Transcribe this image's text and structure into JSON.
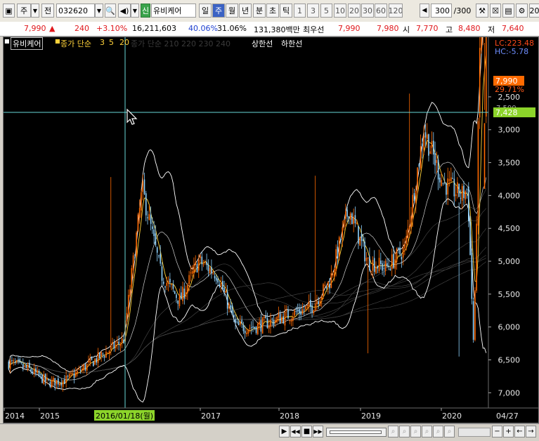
{
  "toolbar": {
    "market_label": "주",
    "prev_label": "전",
    "stock_code": "032620",
    "credit_badge": "신",
    "stock_name": "유비케어",
    "periods": [
      "일",
      "주",
      "월",
      "년",
      "분",
      "초",
      "틱"
    ],
    "selected_period": "주",
    "minute_intervals": [
      "1",
      "3",
      "5",
      "10",
      "20",
      "30",
      "60",
      "120"
    ],
    "count_value": "300",
    "count_total": "/300",
    "edge_label": "20"
  },
  "quote": {
    "price": "7,990",
    "change_arrow": "▲",
    "change": "240",
    "change_pct": "+3.10%",
    "volume": "16,211,603",
    "vol_ratio": "40.06%",
    "turnover_pct": "31.06%",
    "amount": "131,380백만",
    "best_ask_label": "최우선",
    "best_ask": "7,990",
    "best_bid": "7,980",
    "open_label": "시",
    "open": "7,770",
    "high_label": "고",
    "high": "8,480",
    "low_label": "저",
    "low": "7,640"
  },
  "chart_header": {
    "stock": "유비케어",
    "ma_label": "종가 단순",
    "ma_periods": [
      "3",
      "5",
      "20"
    ],
    "ma_periods_faded": "종가 단순 210  220  230  240",
    "upper_band": "상한선",
    "lower_band": "하한선"
  },
  "price_axis": {
    "lc": "LC:223.48",
    "hc": "HC:-5.78",
    "current_tag": "7,990",
    "current_pct": "29.71%",
    "cursor_tag": "7,428",
    "partial_tick": "7,500",
    "ticks": [
      "7,000",
      "6,500",
      "6,000",
      "5,500",
      "5,000",
      "4,500",
      "4,000",
      "3,500",
      "3,000",
      "2,500"
    ]
  },
  "time_axis": {
    "labels": [
      "2014",
      "2015",
      "2017",
      "2018",
      "2019",
      "2020"
    ],
    "cursor_date": "2016/01/18(월)",
    "right_label": "04/27"
  },
  "colors": {
    "up": "#ff6a00",
    "down": "#8fd3ff",
    "ma": "#ffd23a",
    "band": "#ffffff",
    "crosshair": "#68d8d8",
    "cursor_tag": "#8cd42a",
    "current_tag": "#ff6a00"
  },
  "chart_data": {
    "type": "candlestick",
    "series": [
      {
        "name": "종가",
        "x": [
          "2014-01",
          "2014-04",
          "2014-07",
          "2014-10",
          "2015-01",
          "2015-04",
          "2015-07",
          "2015-10",
          "2016-01",
          "2016-04",
          "2016-07",
          "2016-10",
          "2017-01",
          "2017-04",
          "2017-07",
          "2017-10",
          "2018-01",
          "2018-04",
          "2018-07",
          "2018-10",
          "2019-01",
          "2019-04",
          "2019-07",
          "2019-10",
          "2020-01",
          "2020-02",
          "2020-03",
          "2020-04"
        ],
        "values": [
          2950,
          2850,
          2650,
          2700,
          2900,
          3100,
          3300,
          5600,
          4300,
          3900,
          4500,
          4300,
          3500,
          3500,
          3600,
          3700,
          3800,
          4200,
          5300,
          4500,
          4400,
          4700,
          6500,
          5700,
          5500,
          5600,
          3100,
          7990
        ]
      }
    ],
    "bands": {
      "upper": "상한선",
      "lower": "하한선"
    },
    "ylim": [
      2300,
      7800
    ],
    "yticks": [
      2500,
      3000,
      3500,
      4000,
      4500,
      5000,
      5500,
      6000,
      6500,
      7000
    ],
    "grid": false
  },
  "bottom": {
    "buttons": [
      "▶",
      "◀◀",
      "■",
      "▶▶",
      "−",
      "+",
      "←",
      "→"
    ]
  }
}
